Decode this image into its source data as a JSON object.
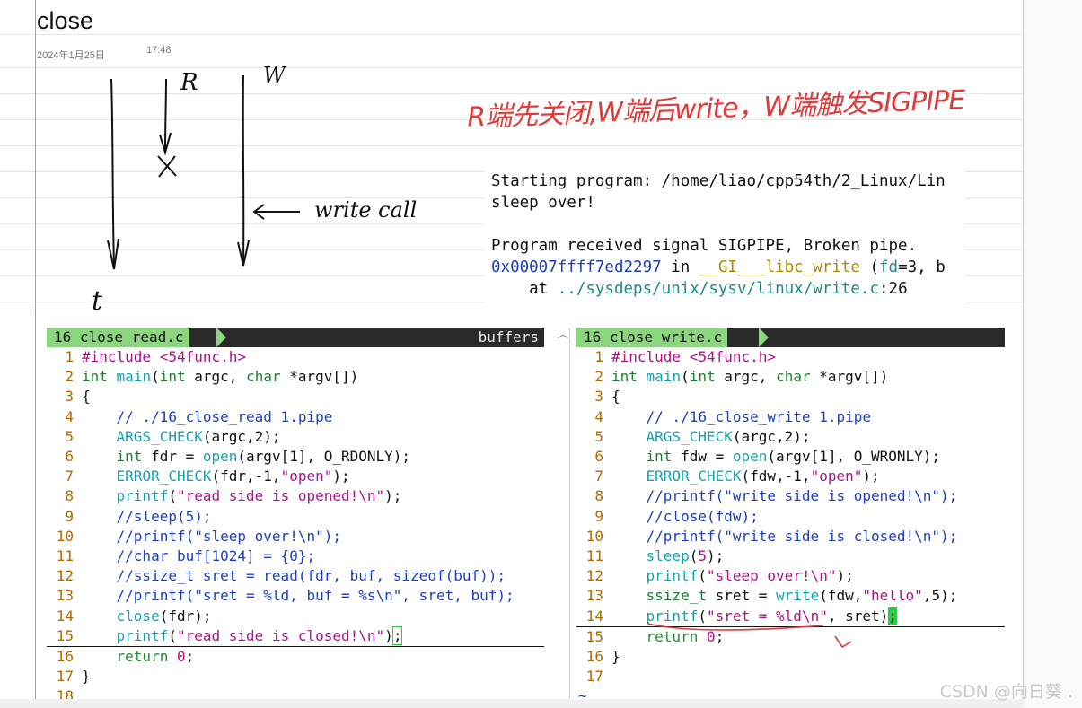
{
  "note": {
    "title": "close",
    "date": "2024年1月25日",
    "time": "17:48"
  },
  "sketch": {
    "label_r": "R",
    "label_w": "W",
    "label_write_call": "write call",
    "label_t": "t"
  },
  "annotation": "R端先关闭,W端后write，W端触发SIGPIPE",
  "gdb": {
    "line1": "Starting program: /home/liao/cpp54th/2_Linux/Lin",
    "line2": "sleep over!",
    "line3": "Program received signal SIGPIPE, Broken pipe.",
    "line4_addr": "0x00007ffff7ed2297",
    "line4_in": " in ",
    "line4_func": "__GI___libc_write",
    "line4_rest": " (",
    "line4_arg": "fd",
    "line4_val": "=3, b",
    "line5_at": "    at ",
    "line5_path": "../sysdeps/unix/sysv/linux/write.c",
    "line5_ln": ":26"
  },
  "left_pane": {
    "filename": "16_close_read.c",
    "buffers": "buffers",
    "lines": [
      {
        "n": "1"
      },
      {
        "n": "2"
      },
      {
        "n": "3"
      },
      {
        "n": "4"
      },
      {
        "n": "5"
      },
      {
        "n": "6"
      },
      {
        "n": "7"
      },
      {
        "n": "8"
      },
      {
        "n": "9"
      },
      {
        "n": "10"
      },
      {
        "n": "11"
      },
      {
        "n": "12"
      },
      {
        "n": "13"
      },
      {
        "n": "14"
      },
      {
        "n": "15"
      },
      {
        "n": "16"
      },
      {
        "n": "17"
      },
      {
        "n": "18"
      }
    ]
  },
  "right_pane": {
    "filename": "16_close_write.c",
    "lines": [
      {
        "n": "1"
      },
      {
        "n": "2"
      },
      {
        "n": "3"
      },
      {
        "n": "4"
      },
      {
        "n": "5"
      },
      {
        "n": "6"
      },
      {
        "n": "7"
      },
      {
        "n": "8"
      },
      {
        "n": "9"
      },
      {
        "n": "10"
      },
      {
        "n": "11"
      },
      {
        "n": "12"
      },
      {
        "n": "13"
      },
      {
        "n": "14"
      },
      {
        "n": "15"
      },
      {
        "n": "16"
      },
      {
        "n": "17"
      }
    ],
    "tilde": "~"
  },
  "code_text": {
    "include": "#include <54func.h>",
    "int": "int",
    "main": "main",
    "main_args_a": "(",
    "main_args_b": " argc, ",
    "char": "char",
    "main_args_c": " *argv[])",
    "brace_open": "{",
    "brace_close": "}",
    "l_comment_read": "// ./16_close_read 1.pipe",
    "r_comment_write": "// ./16_close_write 1.pipe",
    "args_check": "ARGS_CHECK",
    "args_check_rest": "(argc,2);",
    "fdr_decl": " fdr = ",
    "fdw_decl": " fdw = ",
    "open": "open",
    "open_rd": "(argv[1], O_RDONLY);",
    "open_wr": "(argv[1], O_WRONLY);",
    "error_check": "ERROR_CHECK",
    "err_fdr": "(fdr,-1,",
    "err_fdw": "(fdw,-1,",
    "str_open": "\"open\"",
    "err_end": ");",
    "printf": "printf",
    "paren_open": "(",
    "str_read_opened": "\"read side is opened!",
    "esc_n": "\\n",
    "quote": "\"",
    "paren_close_semi": ");",
    "c_sleep5": "//sleep(5);",
    "c_printf_sleep": "//printf(\"sleep over!\\n\");",
    "c_char_buf": "//char buf[1024] = {0};",
    "c_ssize": "//ssize_t sret = read(fdr, buf, sizeof(buf));",
    "c_printf_sret": "//printf(\"sret = %ld, buf = %s\\n\", sret, buf);",
    "close": "close",
    "close_fdr": "(fdr);",
    "str_read_closed": "\"read side is closed!",
    "paren_close": ")",
    "semi": ";",
    "return": "return",
    "zero": " 0",
    "r_c_opened": "//printf(\"write side is opened!\\n\");",
    "r_c_close": "//close(fdw);",
    "r_c_closed": "//printf(\"write side is closed!\\n\");",
    "sleep": "sleep",
    "five": "5",
    "str_sleep_over": "\"sleep over!",
    "ssize_t": "ssize_t",
    "sret_eq": " sret = ",
    "write": "write",
    "write_args_a": "(fdw,",
    "str_hello": "\"hello\"",
    "write_args_b": ",5);",
    "str_sret": "\"sret = %ld",
    "sret_tail": ", sret)"
  },
  "watermark": "CSDN @向日葵 ."
}
